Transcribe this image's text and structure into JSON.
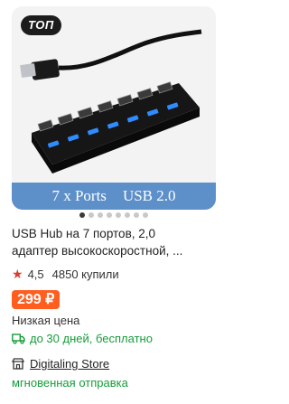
{
  "product": {
    "badge": "ТОП",
    "banner_left": "7 x Ports",
    "banner_right": "USB 2.0",
    "carousel": {
      "count": 8,
      "active_index": 0
    },
    "title_line1": "USB Hub на 7 портов, 2,0",
    "title_line2": "адаптер высокоскоростной, ...",
    "rating": "4,5",
    "sold": "4850 купили",
    "price": "299 ₽",
    "price_note": "Низкая цена",
    "delivery": "до 30 дней, бесплатно",
    "store_name": "Digitaling Store",
    "dispatch": "мгновенная отправка"
  },
  "colors": {
    "price_bg": "#ff5e1f",
    "green": "#169c3a",
    "star": "#d8402e",
    "badge_bg": "#1c1c1c",
    "banner_bg": "#5d8fc9"
  },
  "icons": {
    "rating": "star-icon",
    "delivery": "truck-icon",
    "store": "store-icon"
  }
}
